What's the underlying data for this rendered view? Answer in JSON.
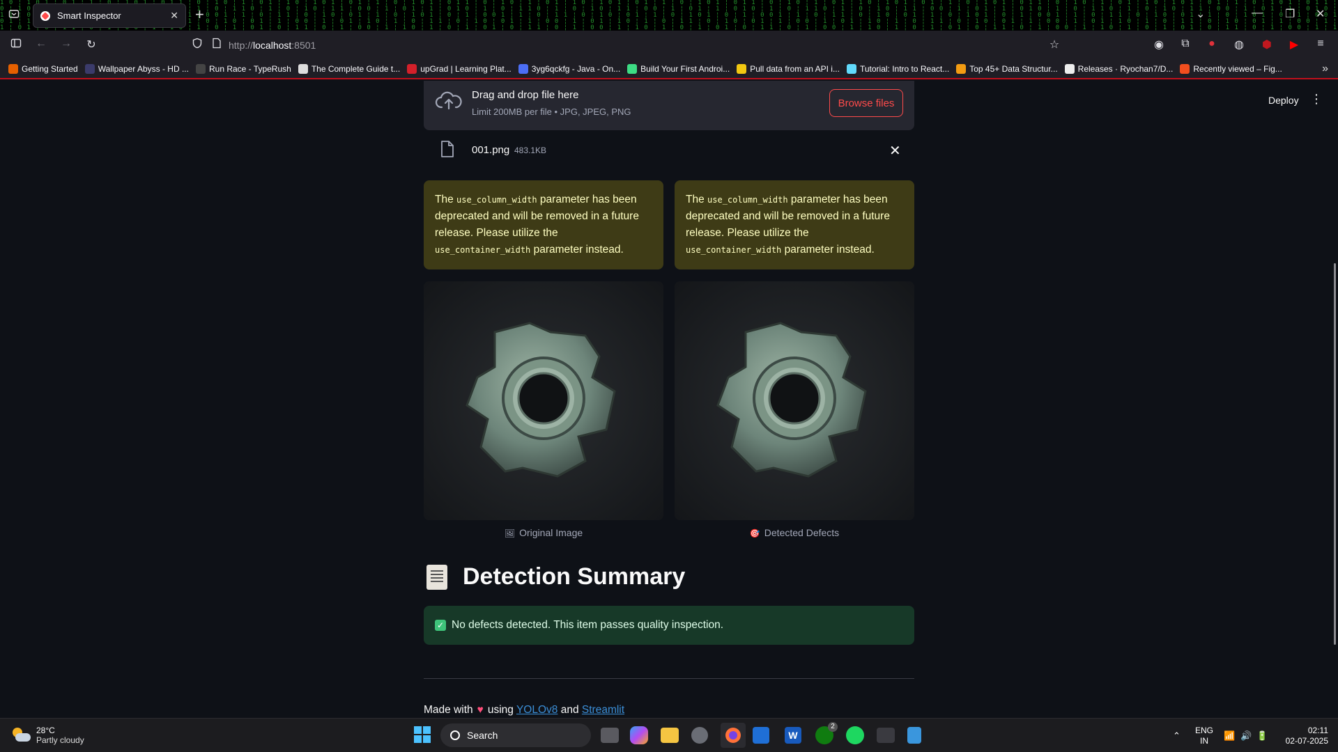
{
  "browser": {
    "tab_title": "Smart Inspector",
    "url_prefix": "http://",
    "url_host": "localhost",
    "url_port": ":8501",
    "bookmarks": [
      {
        "label": "Getting Started",
        "color": "#e66000"
      },
      {
        "label": "Wallpaper Abyss - HD ...",
        "color": "#3b3b6b"
      },
      {
        "label": "Run Race - TypeRush",
        "color": "#444"
      },
      {
        "label": "The Complete Guide t...",
        "color": "#ddd"
      },
      {
        "label": "upGrad | Learning Plat...",
        "color": "#d4202a"
      },
      {
        "label": "3yg6qckfg - Java - On...",
        "color": "#4c6ef5"
      },
      {
        "label": "Build Your First Androi...",
        "color": "#3ddc84"
      },
      {
        "label": "Pull data from an API i...",
        "color": "#f2c811"
      },
      {
        "label": "Tutorial: Intro to React...",
        "color": "#61dafb"
      },
      {
        "label": "Top 45+ Data Structur...",
        "color": "#f39c12"
      },
      {
        "label": "Releases · Ryochan7/D...",
        "color": "#eee"
      },
      {
        "label": "Recently viewed – Fig...",
        "color": "#f24e1e"
      }
    ]
  },
  "app": {
    "deploy_label": "Deploy",
    "uploader": {
      "title": "Drag and drop file here",
      "subtitle": "Limit 200MB per file • JPG, JPEG, PNG",
      "browse_label": "Browse files"
    },
    "file": {
      "name": "001.png",
      "size": "483.1KB"
    },
    "warning": {
      "pre": "The ",
      "code1": "use_column_width",
      "mid": " parameter has been deprecated and will be removed in a future release. Please utilize the ",
      "code2": "use_container_width",
      "post": " parameter instead."
    },
    "captions": {
      "original": "Original Image",
      "detected": "Detected Defects"
    },
    "summary_heading": "Detection Summary",
    "success_message": "No defects detected. This item passes quality inspection.",
    "footer": {
      "made_with": "Made with",
      "using": "using",
      "link1": "YOLOv8",
      "and": "and",
      "link2": "Streamlit"
    }
  },
  "taskbar": {
    "temperature": "28°C",
    "weather": "Partly cloudy",
    "search_label": "Search",
    "xbox_badge": "2",
    "lang_top": "ENG",
    "lang_bottom": "IN",
    "time": "02:11",
    "date": "02-07-2025"
  }
}
